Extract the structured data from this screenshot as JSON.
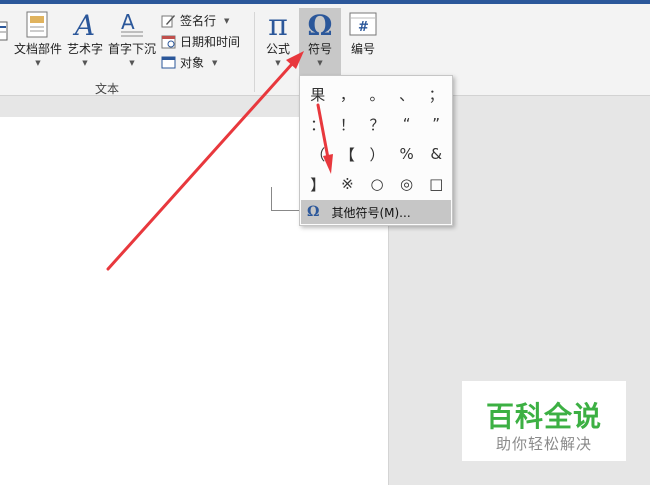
{
  "ribbon": {
    "text_group_label": "文本",
    "buttons": {
      "docparts": "文档部件",
      "wordart": "艺术字",
      "dropcap": "首字下沉",
      "signature": "签名行",
      "datetime": "日期和时间",
      "object": "对象",
      "formula": "公式",
      "symbol": "符号",
      "number": "编号"
    },
    "icons": {
      "wordart_glyph": "A",
      "formula_glyph": "π",
      "symbol_glyph": "Ω",
      "number_glyph": "#"
    }
  },
  "symbol_menu": {
    "symbols": [
      "果",
      "，",
      "。",
      "、",
      "；",
      "：",
      "！",
      "？",
      "“",
      "”",
      "（",
      "【",
      "）",
      "%",
      "&",
      "】",
      "※",
      "○",
      "◎",
      "□"
    ],
    "more_symbols_label": "其他符号(M)..."
  },
  "watermark": {
    "title": "百科全说",
    "subtitle": "助你轻松解决"
  },
  "colors": {
    "accent": "#2b579a",
    "arrow": "#e8383d",
    "logo_green": "#3cb043"
  }
}
